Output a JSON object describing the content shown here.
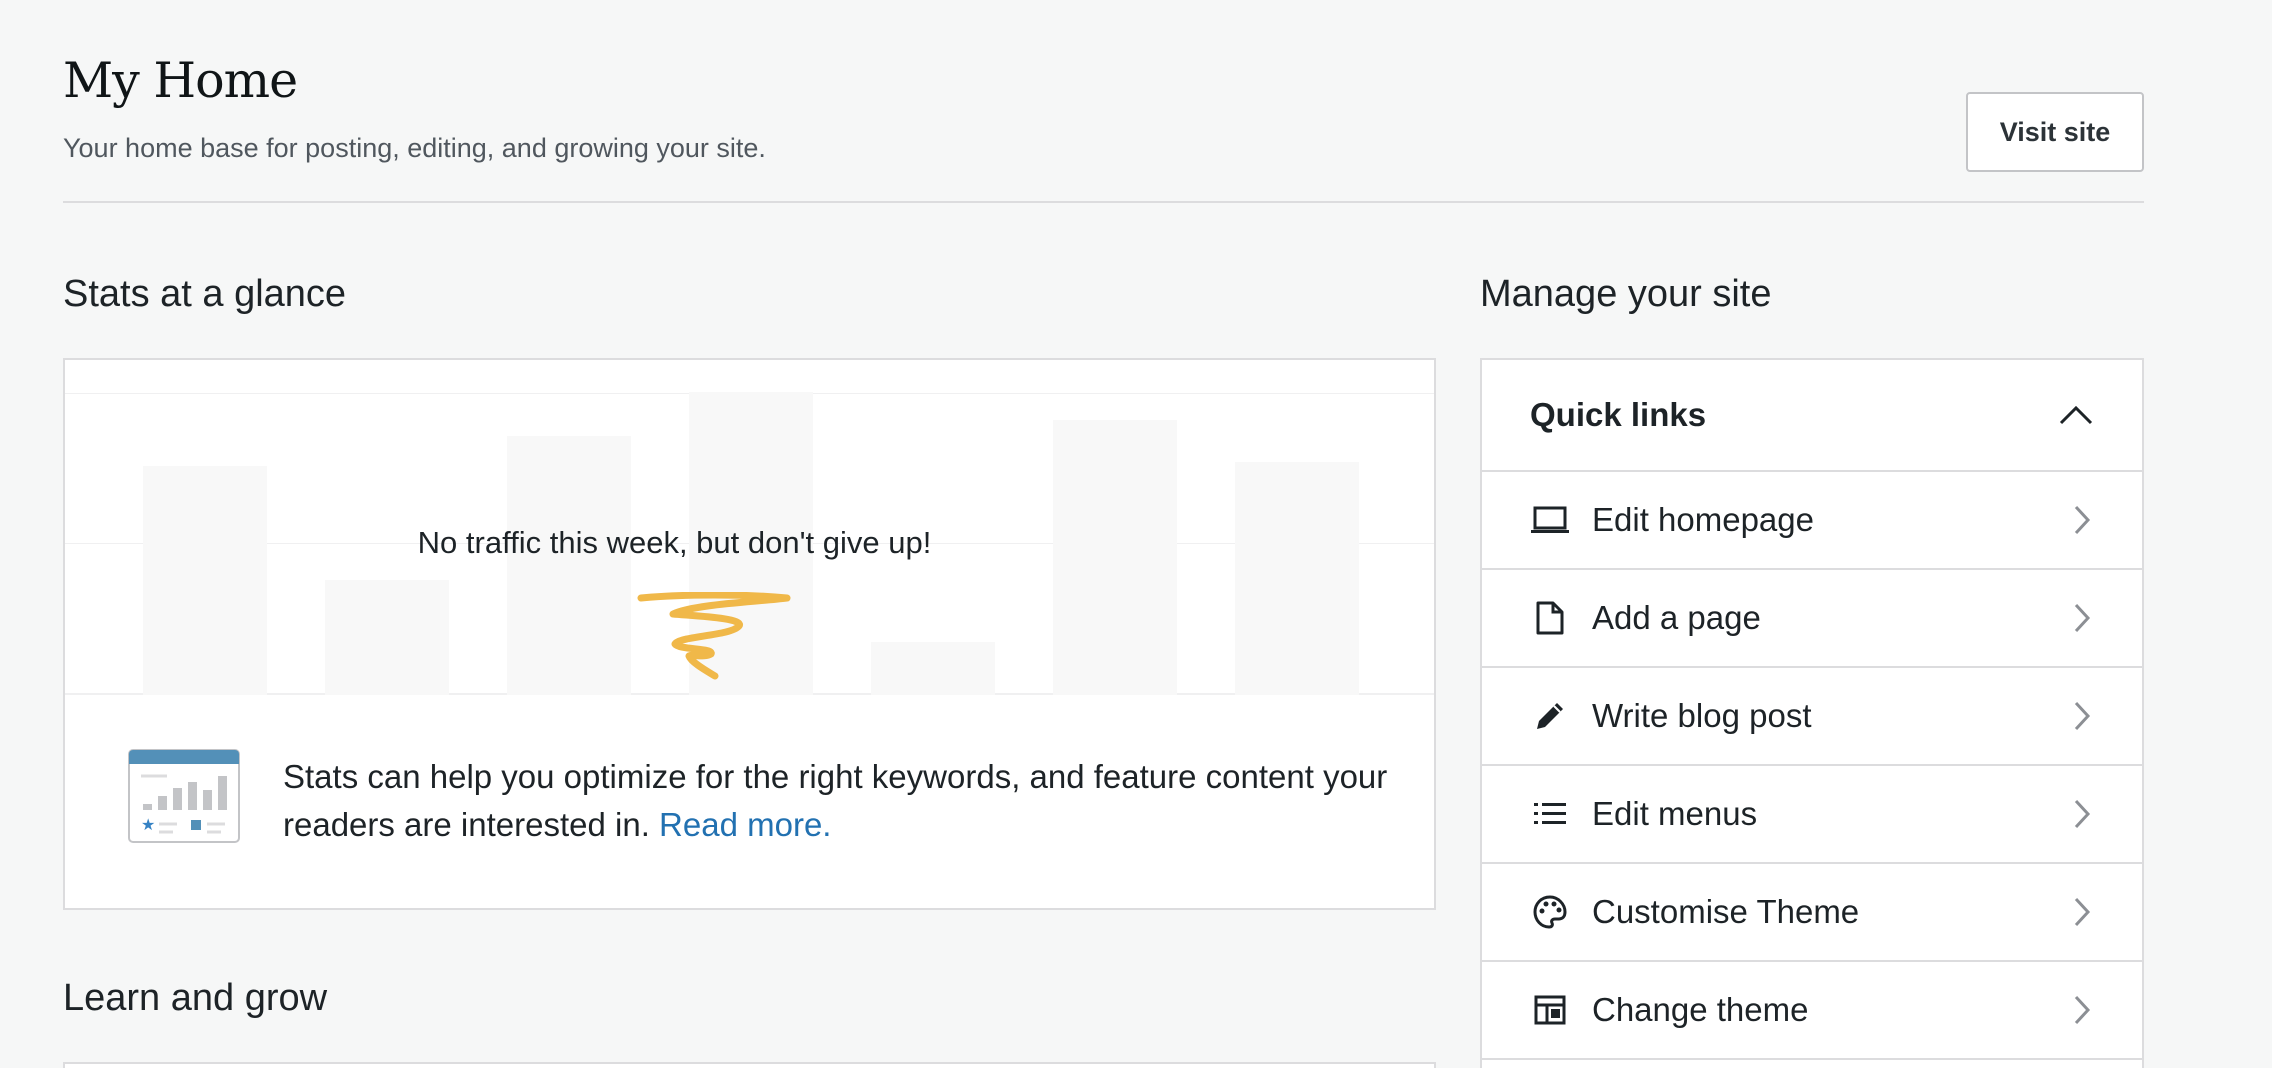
{
  "header": {
    "title": "My Home",
    "subtitle": "Your home base for posting, editing, and growing your site.",
    "visit_site_label": "Visit site"
  },
  "stats": {
    "heading": "Stats at a glance",
    "empty_message": "No traffic this week, but don't give up!",
    "promo_text": "Stats can help you optimize for the right keywords, and feature content your readers are interested in.",
    "read_more_label": "Read more."
  },
  "manage": {
    "heading": "Manage your site",
    "quick_links": {
      "title": "Quick links",
      "expanded": true,
      "items": [
        {
          "label": "Edit homepage",
          "icon": "laptop-icon"
        },
        {
          "label": "Add a page",
          "icon": "page-icon"
        },
        {
          "label": "Write blog post",
          "icon": "pencil-icon"
        },
        {
          "label": "Edit menus",
          "icon": "list-icon"
        },
        {
          "label": "Customise Theme",
          "icon": "palette-icon"
        },
        {
          "label": "Change theme",
          "icon": "layout-icon"
        }
      ]
    }
  },
  "learn": {
    "heading": "Learn and grow"
  },
  "colors": {
    "accent_link": "#2271b1",
    "squiggle": "#f0b849",
    "background": "#f6f7f7"
  }
}
